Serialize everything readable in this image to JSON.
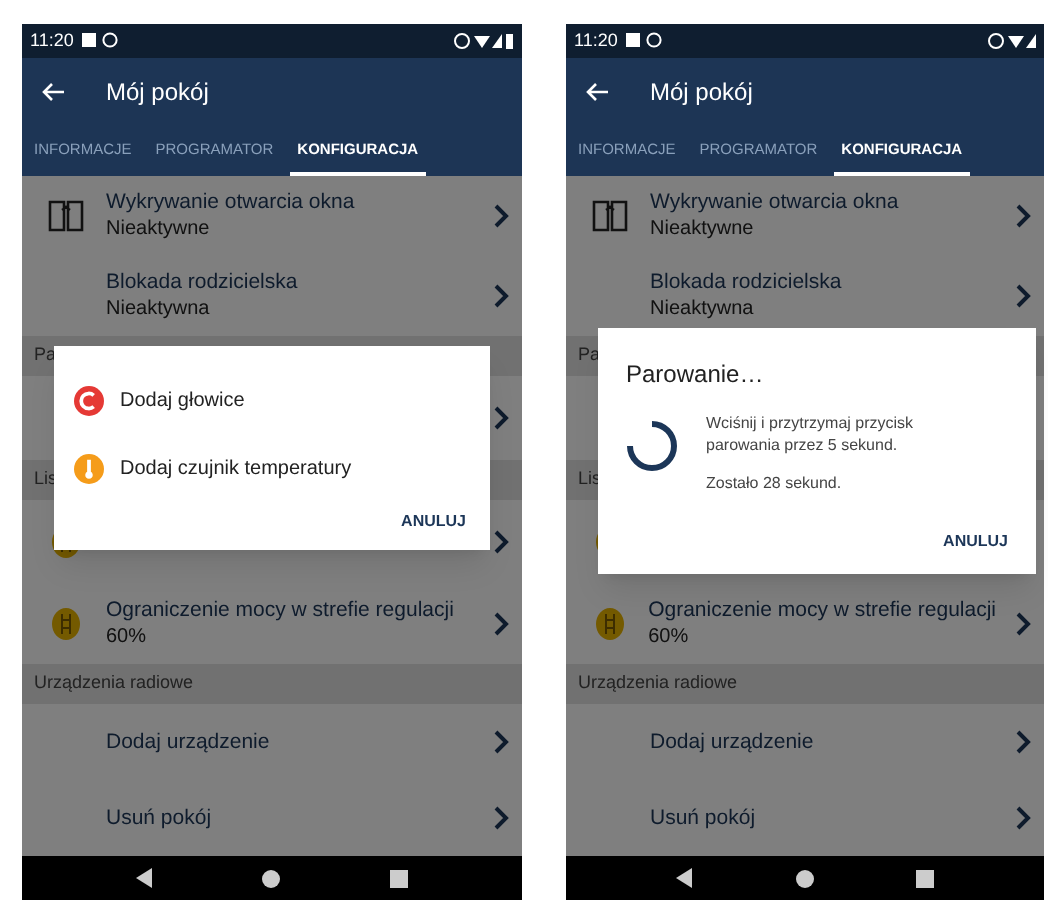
{
  "screens": [
    {
      "status_bar": {
        "time": "11:20",
        "battery": true
      },
      "app_bar": {
        "title": "Mój pokój"
      },
      "tabs": [
        {
          "label": "INFORMACJE",
          "selected": false
        },
        {
          "label": "PROGRAMATOR",
          "selected": false
        },
        {
          "label": "KONFIGURACJA",
          "selected": true
        }
      ],
      "list": [
        {
          "kind": "window",
          "title": "Wykrywanie otwarcia okna",
          "subtitle": "Nieaktywne"
        },
        {
          "kind": "plain",
          "title": "Blokada rodzicielska",
          "subtitle": "Nieaktywna"
        },
        {
          "kind": "header",
          "title": "Pa"
        },
        {
          "kind": "hidden"
        },
        {
          "kind": "header",
          "title": "Lis"
        },
        {
          "kind": "limit-hidden"
        },
        {
          "kind": "limit",
          "title": "Ograniczenie mocy w strefie regulacji",
          "subtitle": "60%"
        },
        {
          "kind": "header",
          "title": "Urządzenia radiowe"
        },
        {
          "kind": "plain",
          "title": "Dodaj urządzenie"
        },
        {
          "kind": "plain",
          "title": "Usuń pokój"
        }
      ],
      "dialog": {
        "kind": "menu",
        "items": [
          {
            "kind": "valve",
            "label": "Dodaj głowice"
          },
          {
            "kind": "sensor",
            "label": "Dodaj czujnik temperatury"
          }
        ],
        "button": "ANULUJ"
      }
    },
    {
      "status_bar": {
        "time": "11:20",
        "battery": false
      },
      "app_bar": {
        "title": "Mój pokój"
      },
      "tabs": [
        {
          "label": "INFORMACJE",
          "selected": false
        },
        {
          "label": "PROGRAMATOR",
          "selected": false
        },
        {
          "label": "KONFIGURACJA",
          "selected": true
        }
      ],
      "list": [
        {
          "kind": "window",
          "title": "Wykrywanie otwarcia okna",
          "subtitle": "Nieaktywne"
        },
        {
          "kind": "plain",
          "title": "Blokada rodzicielska",
          "subtitle": "Nieaktywna"
        },
        {
          "kind": "header",
          "title": "Pa"
        },
        {
          "kind": "hidden"
        },
        {
          "kind": "header",
          "title": "Lis"
        },
        {
          "kind": "limit-hidden"
        },
        {
          "kind": "limit",
          "title": "Ograniczenie mocy w strefie regulacji",
          "subtitle": "60%"
        },
        {
          "kind": "header",
          "title": "Urządzenia radiowe"
        },
        {
          "kind": "plain",
          "title": "Dodaj urządzenie"
        },
        {
          "kind": "plain",
          "title": "Usuń pokój"
        }
      ],
      "dialog": {
        "kind": "progress",
        "title": "Parowanie…",
        "message": "Wciśnij i przytrzymaj przycisk parowania przez 5 sekund.",
        "remaining": "Zostało 28 sekund.",
        "button": "ANULUJ"
      }
    }
  ]
}
